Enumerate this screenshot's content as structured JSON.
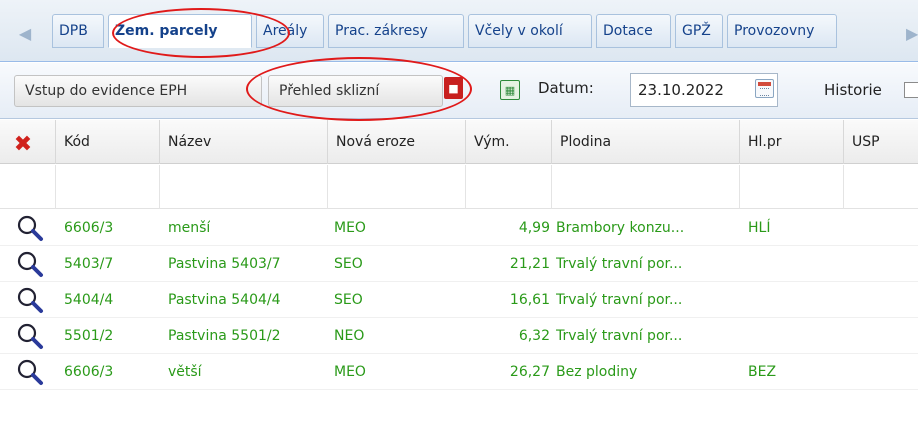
{
  "tabs": [
    {
      "label": "DPB"
    },
    {
      "label": "Zem. parcely",
      "active": true
    },
    {
      "label": "Areály"
    },
    {
      "label": "Prac. zákresy"
    },
    {
      "label": "Včely v okolí"
    },
    {
      "label": "Dotace"
    },
    {
      "label": "GPŽ"
    },
    {
      "label": "Provozovny"
    }
  ],
  "toolbar": {
    "vstup_label": "Vstup do evidence EPH",
    "prehled_label": "Přehled sklizní",
    "pdf_icon": "PDF",
    "xls_icon": "XLS",
    "datum_label": "Datum:",
    "datum_value": "23.10.2022",
    "historie_label": "Historie"
  },
  "columns": [
    "Kód",
    "Název",
    "Nová eroze",
    "Vým.",
    "Plodina",
    "Hl.pr",
    "USP"
  ],
  "rows": [
    {
      "kod": "6606/3",
      "nazev": "menší",
      "eroze": "MEO",
      "vym": "4,99",
      "plodina": "Brambory konzu...",
      "hlpr": "HLÍ",
      "usp": ""
    },
    {
      "kod": "5403/7",
      "nazev": "Pastvina 5403/7",
      "eroze": "SEO",
      "vym": "21,21",
      "plodina": "Trvalý travní por...",
      "hlpr": "",
      "usp": ""
    },
    {
      "kod": "5404/4",
      "nazev": "Pastvina 5404/4",
      "eroze": "SEO",
      "vym": "16,61",
      "plodina": "Trvalý travní por...",
      "hlpr": "",
      "usp": ""
    },
    {
      "kod": "5501/2",
      "nazev": "Pastvina 5501/2",
      "eroze": "NEO",
      "vym": "6,32",
      "plodina": "Trvalý travní por...",
      "hlpr": "",
      "usp": ""
    },
    {
      "kod": "6606/3",
      "nazev": "větší",
      "eroze": "MEO",
      "vym": "26,27",
      "plodina": "Bez plodiny",
      "hlpr": "BEZ",
      "usp": ""
    }
  ],
  "colors": {
    "row_text": "#2a9a19",
    "tab_text": "#15428b",
    "annotation": "#e01a1a",
    "delete_icon": "#d0211c"
  },
  "icons": {
    "nav_left": "arrow-left-icon",
    "nav_right": "arrow-right-icon",
    "delete": "delete-x-icon",
    "row_detail": "magnifier-icon",
    "pdf": "pdf-icon",
    "excel": "excel-icon",
    "calendar": "calendar-icon"
  }
}
